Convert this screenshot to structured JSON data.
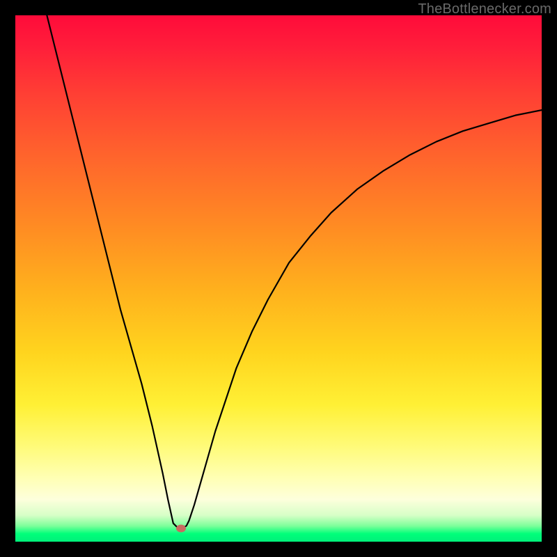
{
  "watermark": "TheBottlenecker.com",
  "palette": {
    "frame_bg": "#000000",
    "gradient_top": "#ff0b3a",
    "gradient_mid1": "#ff8b23",
    "gradient_mid2": "#fff035",
    "gradient_bottom": "#00f07a",
    "curve_stroke": "#000000",
    "dot_fill": "#c86b60",
    "watermark_color": "#6a6a6a"
  },
  "chart_data": {
    "type": "line",
    "title": "",
    "xlabel": "",
    "ylabel": "",
    "xlim": [
      0,
      100
    ],
    "ylim": [
      0,
      100
    ],
    "legend": false,
    "grid": false,
    "x": [
      6,
      8,
      10,
      12,
      14,
      16,
      18,
      20,
      22,
      24,
      26,
      28,
      29,
      30,
      31,
      31.5,
      32.5,
      33,
      34,
      36,
      38,
      40,
      42,
      45,
      48,
      52,
      56,
      60,
      65,
      70,
      75,
      80,
      85,
      90,
      95,
      100
    ],
    "y": [
      100,
      92,
      84,
      76,
      68,
      60,
      52,
      44,
      37,
      30,
      22,
      13,
      8,
      3.5,
      2.5,
      2.5,
      3,
      4,
      7,
      14,
      21,
      27,
      33,
      40,
      46,
      53,
      58,
      62.5,
      67,
      70.5,
      73.5,
      76,
      78,
      79.5,
      81,
      82
    ],
    "marker": {
      "x": 31.5,
      "y": 2.5
    },
    "notes": "V-shaped bottleneck curve; values are percentages estimated from pixel positions on an unlabeled axis."
  }
}
